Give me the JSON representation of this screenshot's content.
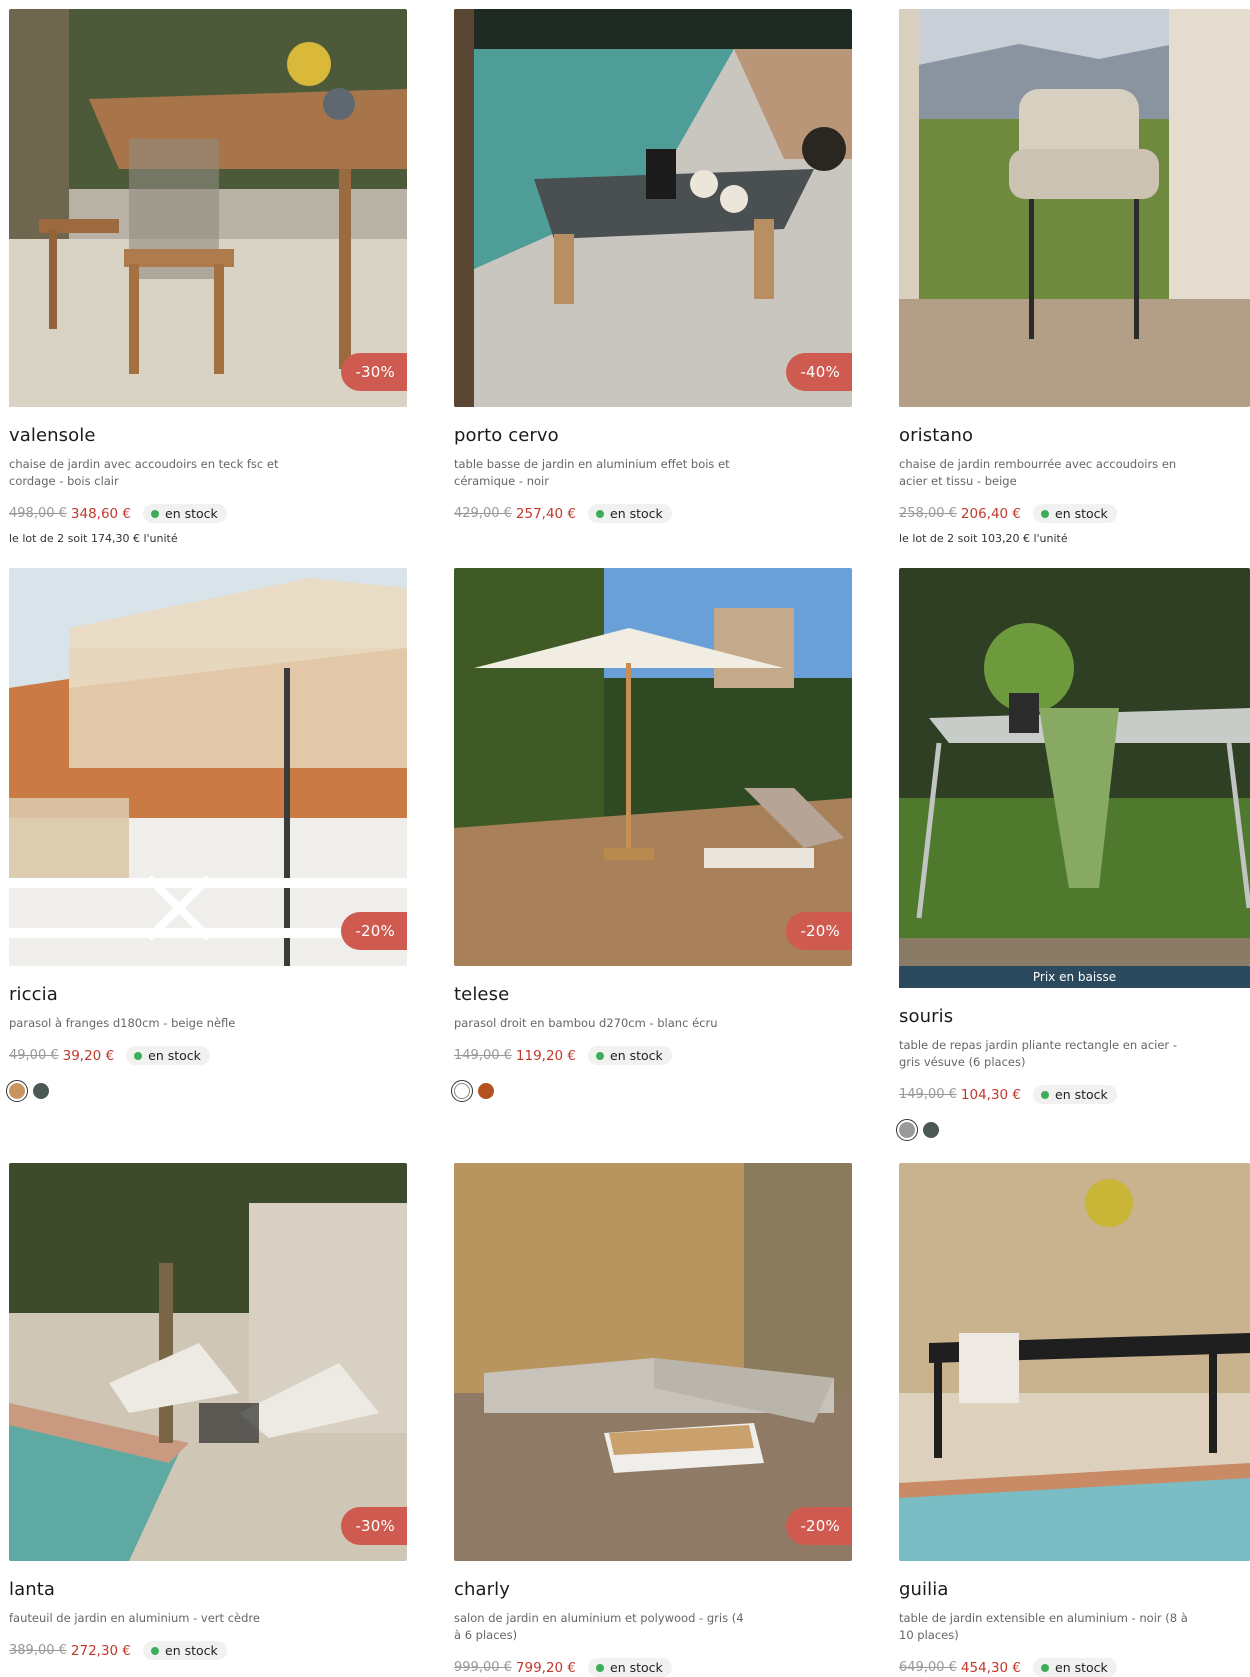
{
  "products": [
    {
      "name": "valensole",
      "desc": "chaise de jardin avec accoudoirs en teck fsc et cordage - bois clair",
      "old_price": "498,00 €",
      "price": "348,60 €",
      "stock": "en stock",
      "discount": "-30%",
      "lot": "le lot de 2 soit 174,30 € l'unité"
    },
    {
      "name": "porto cervo",
      "desc": "table basse de jardin en aluminium effet bois et céramique - noir",
      "old_price": "429,00 €",
      "price": "257,40 €",
      "stock": "en stock",
      "discount": "-40%"
    },
    {
      "name": "oristano",
      "desc": "chaise de jardin rembourrée avec accoudoirs en acier et tissu - beige",
      "old_price": "258,00 €",
      "price": "206,40 €",
      "stock": "en stock",
      "lot": "le lot de 2 soit 103,20 € l'unité"
    },
    {
      "name": "riccia",
      "desc": "parasol à franges d180cm - beige nèfle",
      "old_price": "49,00 €",
      "price": "39,20 €",
      "stock": "en stock",
      "discount": "-20%",
      "swatches": [
        "#c8955e",
        "#4a5a52"
      ]
    },
    {
      "name": "telese",
      "desc": "parasol droit en bambou d270cm - blanc écru",
      "old_price": "149,00 €",
      "price": "119,20 €",
      "stock": "en stock",
      "discount": "-20%",
      "swatches": [
        "#ffffff",
        "#b5501f"
      ]
    },
    {
      "name": "souris",
      "desc": "table de repas jardin pliante rectangle en acier - gris vésuve (6 places)",
      "old_price": "149,00 €",
      "price": "104,30 €",
      "stock": "en stock",
      "ribbon": "Prix en baisse",
      "swatches": [
        "#9a9a98",
        "#4a5a52"
      ]
    },
    {
      "name": "lanta",
      "desc": "fauteuil de jardin en aluminium - vert cèdre",
      "old_price": "389,00 €",
      "price": "272,30 €",
      "stock": "en stock",
      "discount": "-30%"
    },
    {
      "name": "charly",
      "desc": "salon de jardin en aluminium et polywood - gris (4 à 6 places)",
      "old_price": "999,00 €",
      "price": "799,20 €",
      "stock": "en stock",
      "discount": "-20%"
    },
    {
      "name": "guilia",
      "desc": "table de jardin extensible en aluminium - noir (8 à 10 places)",
      "old_price": "649,00 €",
      "price": "454,30 €",
      "stock": "en stock"
    }
  ]
}
